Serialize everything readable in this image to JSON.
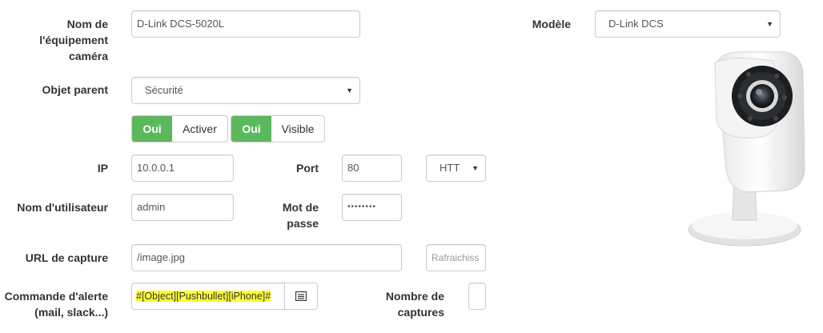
{
  "form": {
    "name_label": "Nom de l'équipement caméra",
    "name_value": "D-Link DCS-5020L",
    "parent_label": "Objet parent",
    "parent_value": "Sécurité",
    "activate_on": "Oui",
    "activate_label": "Activer",
    "visible_on": "Oui",
    "visible_label": "Visible",
    "ip_label": "IP",
    "ip_value": "10.0.0.1",
    "port_label": "Port",
    "port_value": "80",
    "protocol_value": "HTT",
    "user_label": "Nom d'utilisateur",
    "user_value": "admin",
    "password_label": "Mot de passe",
    "password_value": "••••••••",
    "url_label": "URL de capture",
    "url_value": "/image.jpg",
    "refresh_placeholder": "Rafraichiss",
    "alert_label": "Commande d'alerte (mail, slack...)",
    "alert_value": "#[Object][Pushbullet][iPhone]#",
    "captures_label": "Nombre de captures",
    "captures_value": ""
  },
  "model": {
    "label": "Modèle",
    "value": "D-Link DCS"
  },
  "colors": {
    "accent_green": "#5cb85c",
    "highlight": "#ffff33"
  },
  "icons": {
    "alert_addon": "list-box-icon",
    "camera_image": "dlink-camera-image"
  }
}
